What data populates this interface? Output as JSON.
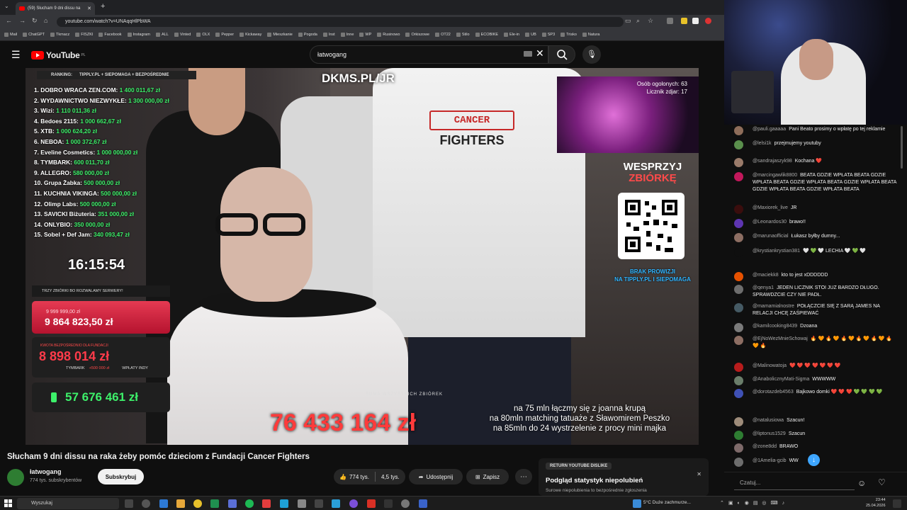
{
  "browser": {
    "tab_title": "(59) Słucham 9 dni dissu na",
    "url": "youtube.com/watch?v=UNAqqHlPbWA",
    "bookmarks": [
      "Mail",
      "ChatGPT",
      "Tkmacz",
      "FISZKI",
      "Facebook",
      "Instagram",
      "ALL",
      "Vinted",
      "OLX",
      "Pepper",
      "Kickaway",
      "Mieszkanie",
      "Pogoda",
      "Inst",
      "Inne",
      "WP",
      "Rusinowo",
      "Orkiszowe",
      "OT22",
      "Stilo",
      "ECOBIKE",
      "Ele-in",
      "UB",
      "SP3",
      "Trisko",
      "Natura"
    ]
  },
  "header": {
    "logo_text": "YouTube",
    "logo_region": "PL",
    "search_value": "łatwogang"
  },
  "overlay": {
    "ranking_label": "RANKING:",
    "ranking_source": "TIPPLY.PL + SIEPOMAGA + BEZPOŚREDNIE",
    "ranking": [
      {
        "name": "1. DOBRO WRACA ZEN.COM:",
        "value": "1 400 011,67 zł"
      },
      {
        "name": "2. WYDAWNICTWO NIEZWYKŁE:",
        "value": "1 300 000,00 zł"
      },
      {
        "name": "3. Wizi:",
        "value": "1 110 011,36 zł"
      },
      {
        "name": "4. Bedoes 2115:",
        "value": "1 000 662,67 zł"
      },
      {
        "name": "5. XTB:",
        "value": "1 000 624,20 zł"
      },
      {
        "name": "6. NEBOA:",
        "value": "1 000 372,67 zł"
      },
      {
        "name": "7. Eveline Cosmetics:",
        "value": "1 000 000,00 zł"
      },
      {
        "name": "8. TYMBARK:",
        "value": "600 011,70 zł"
      },
      {
        "name": "9. ALLEGRO:",
        "value": "580 000,00 zł"
      },
      {
        "name": "10. Grupa Żabka:",
        "value": "500 000,00 zł"
      },
      {
        "name": "11. KUCHNIA VIKINGA:",
        "value": "500 000,00 zł"
      },
      {
        "name": "12. Olimp Labs:",
        "value": "500 000,00 zł"
      },
      {
        "name": "13. SAVICKI Biżuteria:",
        "value": "351 000,00 zł"
      },
      {
        "name": "14. ONLYBIO:",
        "value": "350 000,00 zł"
      },
      {
        "name": "15. Sobel + Def Jam:",
        "value": "340 093,47 zł"
      }
    ],
    "timer": "16:15:54",
    "servers_label": "TRZY ZBIÓRKI BO ROZWALAMY SERWERY!",
    "card1_small": "9 999 999,00 zł",
    "card1_big": "9 864 823,50 zł",
    "card2_label": "KWOTA BEZPOŚREDNIO DLA FUNDACJI",
    "card2_big": "8 898 014 zł",
    "card2_sub1": "TYMBARK",
    "card2_sub2": "+500 000 zł",
    "card2_sub3": "WPŁATY INDY",
    "card3_big": "57 676 461 zł",
    "dkms": "DKMS.PL/JR",
    "shaved_count": "Osób ogolonych: 63",
    "counter": "Licznik zdjar: 17",
    "support_1": "WESPRZYJ",
    "support_2": "ZBIÓRKĘ",
    "no_fee_1": "BRAK PROWIZJI",
    "no_fee_2": "NA TIPPLY.PL I SIEPOMAGA",
    "total_label": "SUMA WSZYSTKICH ZBIÓREK",
    "total": "76 433 164 zł",
    "goals": [
      "na 75 mln łączmy się z joanna krupą",
      "na 80mln matching tatuaże z Sławomirem Peszko",
      "na 85mln do 24 wystrzelenie z procy mini majka"
    ]
  },
  "video_meta": {
    "title": "Słucham 9 dni dissu na raka żeby pomóc dzieciom z Fundacji Cancer Fighters",
    "channel": "łatwogang",
    "subscribers": "774 tys. subskrybentów",
    "subscribe": "Subskrybuj",
    "likes": "774 tys.",
    "dislikes": "4,5 tys.",
    "share": "Udostępnij",
    "save": "Zapisz",
    "ryd_badge": "RETURN YOUTUBE DISLIKE",
    "ryd_title": "Podgląd statystyk niepolubień",
    "ryd_sub": "Surowe niepolubienia to bezpośrednie zgłoszenia"
  },
  "chat": {
    "messages": [
      {
        "user": "@pauli.gaaaaa",
        "text": "Pani Beato prosimy o wpłatę po tej reklamie",
        "color": "#8e6d5a"
      },
      {
        "user": "@lelsi1k",
        "text": "przejmujemy youtuby",
        "color": "#5a8f4c"
      },
      {
        "user": "@sandrajaszyk98",
        "text": "Kochana ❤️",
        "color": "#9a7b6a"
      },
      {
        "user": "@marcingawlik8800",
        "text": "BEATA GDZIE WPŁATA BEATA GDZIE WPŁATA BEATA GDZIE WPŁATA BEATA GDZIE WPŁATA BEATA GDZIE WPŁATA BEATA GDZIE WPŁATA BEATA",
        "color": "#c2185b"
      },
      {
        "user": "@Maxiorek_live",
        "text": "JR",
        "color": "#3a0d0d"
      },
      {
        "user": "@Leonardos30",
        "text": "brawo!!",
        "color": "#5e35b1"
      },
      {
        "user": "@marunaofficial",
        "text": "Łukasz byłby dumny...",
        "color": "#8d6e63"
      },
      {
        "user": "@krystiankrystian381",
        "text": "🤍 💚 🤍 LECHIA 🤍 💚 🤍",
        "color": "#0f0f0f"
      },
      {
        "user": "@maciekk8",
        "text": "kto to jest xDDDDDD",
        "color": "#e65100"
      },
      {
        "user": "@qenya1",
        "text": "JEDEN LICZNIK STOI JUZ BARDZO DŁUGO. SPRAWDZCIE CZY NIE PADŁ.",
        "color": "#6d6d6d"
      },
      {
        "user": "@mamamialnostre",
        "text": "POŁĄCZCIE SIĘ Z SARĄ JAMES NA RELACJI CHCĘ ZAŚPIEWAĆ",
        "color": "#455a64"
      },
      {
        "user": "@kamilcooking8439",
        "text": "Dzoana",
        "color": "#7a7a7a"
      },
      {
        "user": "@EjNoWezMnieSchowaj",
        "text": "🔥 🧡 🔥 🧡 🔥 🧡 🔥 🧡 🔥 🧡 🔥 🧡 🔥",
        "color": "#8d6e63"
      },
      {
        "user": "@Malinowatoja",
        "text": "❤️ ❤️ ❤️ ❤️ ❤️ ❤️ ❤️",
        "color": "#b71c1c"
      },
      {
        "user": "@AnabolicznyMati-Sigma",
        "text": "WWWWW",
        "color": "#6a7d6a"
      },
      {
        "user": "@dorotazdeb4563",
        "text": "Bajkowo domki ❤️ ❤️ ❤️ 💚 💚 💚 💚",
        "color": "#3f51b5"
      },
      {
        "user": "@natalusiowa",
        "text": "Szacun!",
        "color": "#9e8c7a"
      },
      {
        "user": "@liptonus1529",
        "text": "Szacun",
        "color": "#2e7d32"
      },
      {
        "user": "@zone8dd",
        "text": "BRAWO",
        "color": "#7e6a6a"
      },
      {
        "user": "@1Amelia-gcib",
        "text": "WW",
        "color": "#6d6d6d"
      }
    ],
    "input_placeholder": "Czatuj..."
  },
  "taskbar": {
    "search": "Wyszukaj",
    "weather": "5°C  Duże zachmurze...",
    "time": "23:44",
    "date": "25.04.2026"
  },
  "colors": {
    "accent_green": "#3df06a",
    "brand_red": "#ff0000",
    "card_red": "#e0294a"
  }
}
